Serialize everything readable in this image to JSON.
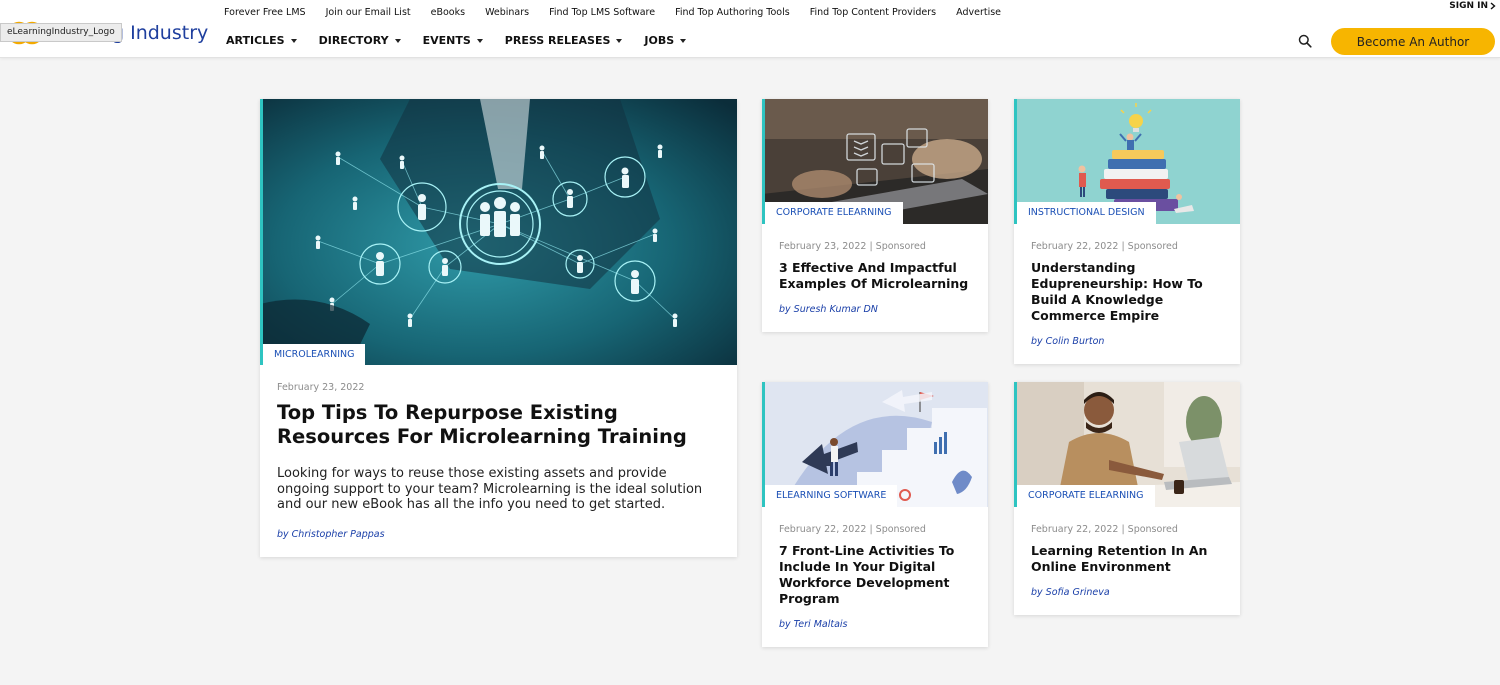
{
  "header": {
    "logo_tooltip": "eLearningIndustry_Logo",
    "logo_text": "g Industry",
    "top_links": [
      "Forever Free LMS",
      "Join our Email List",
      "eBooks",
      "Webinars",
      "Find Top LMS Software",
      "Find Top Authoring Tools",
      "Find Top Content Providers",
      "Advertise"
    ],
    "sign_in": "SIGN IN",
    "main_nav": [
      "ARTICLES",
      "DIRECTORY",
      "EVENTS",
      "PRESS RELEASES",
      "JOBS"
    ],
    "cta_label": "Become An Author",
    "icons": {
      "search": "search-icon",
      "logo": "logo-rings-icon"
    },
    "colors": {
      "cta": "#f7b500",
      "brand_blue": "#1f3f9e",
      "accent_teal": "#2ec4c1"
    }
  },
  "featured": {
    "category": "MICROLEARNING",
    "date": "February 23, 2022",
    "title": "Top Tips To Repurpose Existing Resources For Microlearning Training",
    "excerpt": "Looking for ways to reuse those existing assets and provide ongoing support to your team? Microlearning is the ideal solution and our new eBook has all the info you need to get started.",
    "author": "by Christopher Pappas"
  },
  "articles": [
    {
      "category": "CORPORATE ELEARNING",
      "meta": "February 23, 2022 | Sponsored",
      "title": "3 Effective And Impactful Examples Of Microlearning",
      "author": "by Suresh Kumar DN"
    },
    {
      "category": "INSTRUCTIONAL DESIGN",
      "meta": "February 22, 2022 | Sponsored",
      "title": "Understanding Edupreneurship: How To Build A Knowledge Commerce Empire",
      "author": "by Colin Burton"
    },
    {
      "category": "ELEARNING SOFTWARE",
      "meta": "February 22, 2022 | Sponsored",
      "title": "7 Front-Line Activities To Include In Your Digital Workforce Development Program",
      "author": "by Teri Maltais"
    },
    {
      "category": "CORPORATE ELEARNING",
      "meta": "February 22, 2022 | Sponsored",
      "title": "Learning Retention In An Online Environment",
      "author": "by Sofia Grineva"
    }
  ]
}
